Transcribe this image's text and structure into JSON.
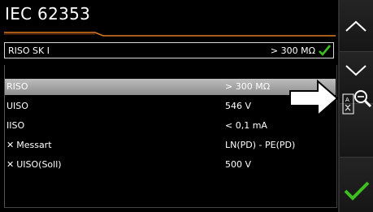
{
  "header": {
    "title": "IEC 62353"
  },
  "summary": {
    "label": "RISO SK I",
    "value": "> 300 MΩ",
    "status_color": "#3cc01e"
  },
  "measurements": [
    {
      "label": "RISO",
      "value": "> 300 MΩ",
      "selected": true,
      "icon": ""
    },
    {
      "label": "UISO",
      "value": "546 V",
      "selected": false,
      "icon": ""
    },
    {
      "label": "IISO",
      "value": "< 0,1 mA",
      "selected": false,
      "icon": ""
    },
    {
      "label": "Messart",
      "value": "LN(PD) - PE(PD)",
      "selected": false,
      "icon": "wrench-icon"
    },
    {
      "label": "UISO(Soll)",
      "value": "500 V",
      "selected": false,
      "icon": "wrench-icon"
    }
  ],
  "sidebar": {
    "zoom_small": "A",
    "zoom_large": "A"
  },
  "colors": {
    "accent_orange": "#e07a1f",
    "check_green": "#3cc01e"
  }
}
